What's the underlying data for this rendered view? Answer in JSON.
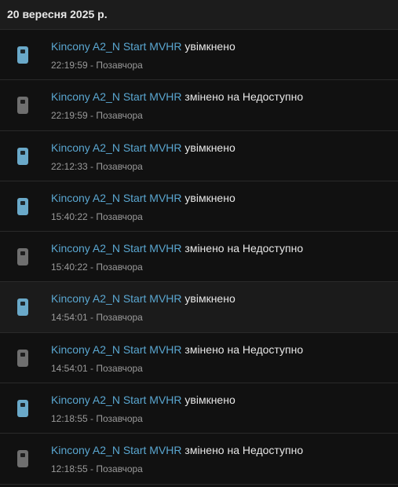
{
  "date_header": "20 вересня 2025 р.",
  "separator": " - ",
  "colors": {
    "on": "#6aa9c9",
    "unavailable": "#6f6f6f",
    "link": "#5aa7d1"
  },
  "entries": [
    {
      "entity": "Kincony A2_N Start MVHR",
      "action": "увімкнено",
      "time": "22:19:59",
      "day": "Позавчора",
      "state": "on"
    },
    {
      "entity": "Kincony A2_N Start MVHR",
      "action": "змінено на Недоступно",
      "time": "22:19:59",
      "day": "Позавчора",
      "state": "unavailable"
    },
    {
      "entity": "Kincony A2_N Start MVHR",
      "action": "увімкнено",
      "time": "22:12:33",
      "day": "Позавчора",
      "state": "on"
    },
    {
      "entity": "Kincony A2_N Start MVHR",
      "action": "увімкнено",
      "time": "15:40:22",
      "day": "Позавчора",
      "state": "on"
    },
    {
      "entity": "Kincony A2_N Start MVHR",
      "action": "змінено на Недоступно",
      "time": "15:40:22",
      "day": "Позавчора",
      "state": "unavailable"
    },
    {
      "entity": "Kincony A2_N Start MVHR",
      "action": "увімкнено",
      "time": "14:54:01",
      "day": "Позавчора",
      "state": "on"
    },
    {
      "entity": "Kincony A2_N Start MVHR",
      "action": "змінено на Недоступно",
      "time": "14:54:01",
      "day": "Позавчора",
      "state": "unavailable"
    },
    {
      "entity": "Kincony A2_N Start MVHR",
      "action": "увімкнено",
      "time": "12:18:55",
      "day": "Позавчора",
      "state": "on"
    },
    {
      "entity": "Kincony A2_N Start MVHR",
      "action": "змінено на Недоступно",
      "time": "12:18:55",
      "day": "Позавчора",
      "state": "unavailable"
    }
  ]
}
